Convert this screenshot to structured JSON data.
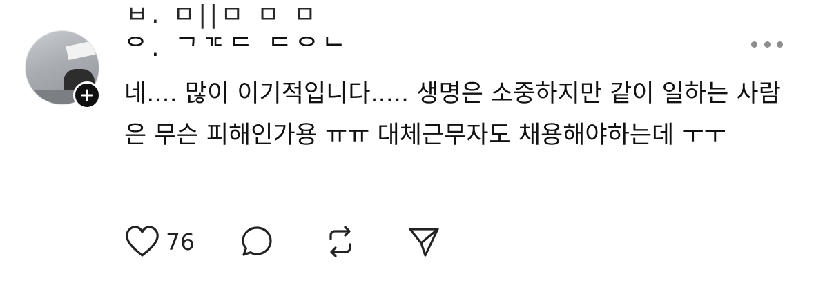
{
  "previous_post_fragment": "ㅂ. ㅁ||ㅁ ㅁ ㅁ",
  "post": {
    "username": "ᄋ. ᄀᄀᄃᄃ ᄃᄋᄂ",
    "text": "네.... 많이 이기적입니다..... 생명은 소중하지만 같이 일하는 사람은 무슨 피해인가용 ㅠㅠ 대체근무자도 채용해야하는데 ㅜㅜ",
    "likes": "76"
  },
  "icons": {
    "more": "more-horizontal-icon",
    "like": "heart-icon",
    "reply": "comment-bubble-icon",
    "repost": "repost-icon",
    "share": "send-icon",
    "follow": "plus-icon"
  }
}
